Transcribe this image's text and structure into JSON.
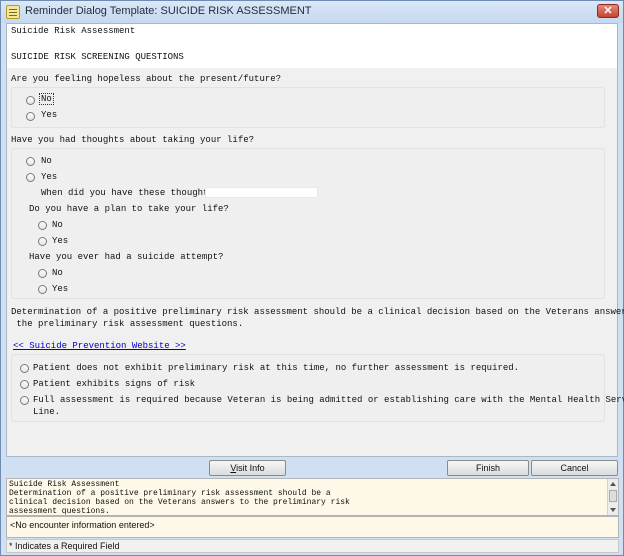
{
  "window": {
    "title": "Reminder Dialog Template: SUICIDE RISK ASSESSMENT",
    "close_label": "✕"
  },
  "dialog": {
    "heading": "Suicide Risk Assessment",
    "section_title": "SUICIDE RISK SCREENING QUESTIONS",
    "q1": {
      "question": "Are you feeling hopeless about the present/future?",
      "options": [
        "No",
        "Yes"
      ]
    },
    "q2": {
      "question": "Have you had thoughts about taking your life?",
      "options": [
        "No",
        "Yes"
      ],
      "followup_when": "When did you have these thoughts?",
      "followup_when_value": "",
      "plan_question": "Do you have a plan to take your life?",
      "plan_options": [
        "No",
        "Yes"
      ],
      "attempt_question": "Have you ever had a suicide attempt?",
      "attempt_options": [
        "No",
        "Yes"
      ]
    },
    "determination_line1": "Determination of a positive preliminary risk assessment should be a clinical decision based on the Veterans answers to",
    "determination_line2": " the preliminary risk assessment questions.",
    "link_text": "<< Suicide Prevention Website >>",
    "outcomes": [
      "Patient does not exhibit preliminary risk at this time, no further assessment is required.",
      "Patient exhibits signs of risk",
      "Full assessment is required because Veteran is being admitted or establishing care with the Mental Health Service",
      "Line."
    ]
  },
  "buttons": {
    "visit_info_pre": "",
    "visit_info_ul": "V",
    "visit_info_post": "isit Info",
    "finish": "Finish",
    "cancel": "Cancel"
  },
  "preview": {
    "lines": [
      "Suicide Risk Assessment",
      "Determination of a positive preliminary risk assessment should be a",
      "clinical decision based on the Veterans answers to the preliminary risk",
      "assessment questions."
    ]
  },
  "encounter_text": "<No encounter information entered>",
  "status_text": "* Indicates a Required Field"
}
